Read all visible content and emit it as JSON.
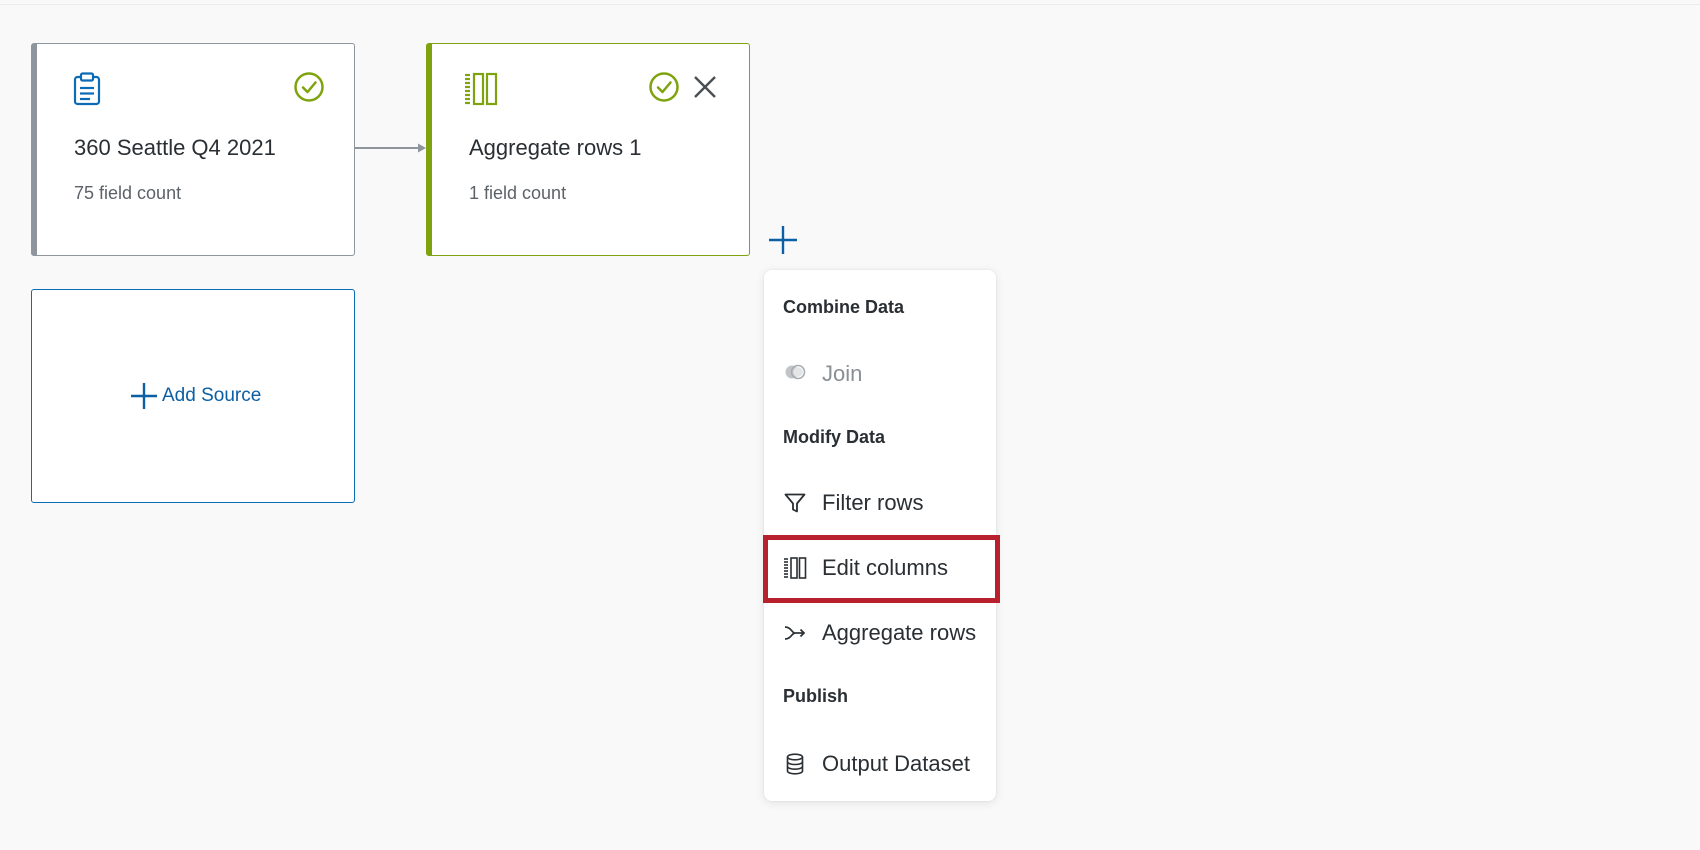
{
  "canvas": {
    "nodes": [
      {
        "id": "source",
        "title": "360 Seattle Q4 2021",
        "field_count": "75 field count",
        "icon": "clipboard-icon",
        "status": "check-circle-icon",
        "accent": "#8e959c"
      },
      {
        "id": "aggregate",
        "title": "Aggregate rows 1",
        "field_count": "1 field count",
        "icon": "columns-icon",
        "status": "check-circle-icon",
        "close_icon": "close-icon",
        "accent": "#7fa30f"
      }
    ],
    "add_source": {
      "label": "Add Source",
      "icon": "plus-icon"
    },
    "add_step_icon": "plus-icon"
  },
  "menu": {
    "sections": [
      {
        "title": "Combine Data",
        "items": [
          {
            "label": "Join",
            "icon": "join-icon",
            "disabled": true
          }
        ]
      },
      {
        "title": "Modify Data",
        "items": [
          {
            "label": "Filter rows",
            "icon": "filter-icon"
          },
          {
            "label": "Edit columns",
            "icon": "edit-columns-icon",
            "highlighted": true
          },
          {
            "label": "Aggregate rows",
            "icon": "aggregate-icon"
          }
        ]
      },
      {
        "title": "Publish",
        "items": [
          {
            "label": "Output Dataset",
            "icon": "database-icon"
          }
        ]
      }
    ]
  },
  "colors": {
    "background": "#f9f9f9",
    "link_blue": "#0b5fa5",
    "success_green": "#7fa30f",
    "highlight_red": "#b8202e"
  }
}
